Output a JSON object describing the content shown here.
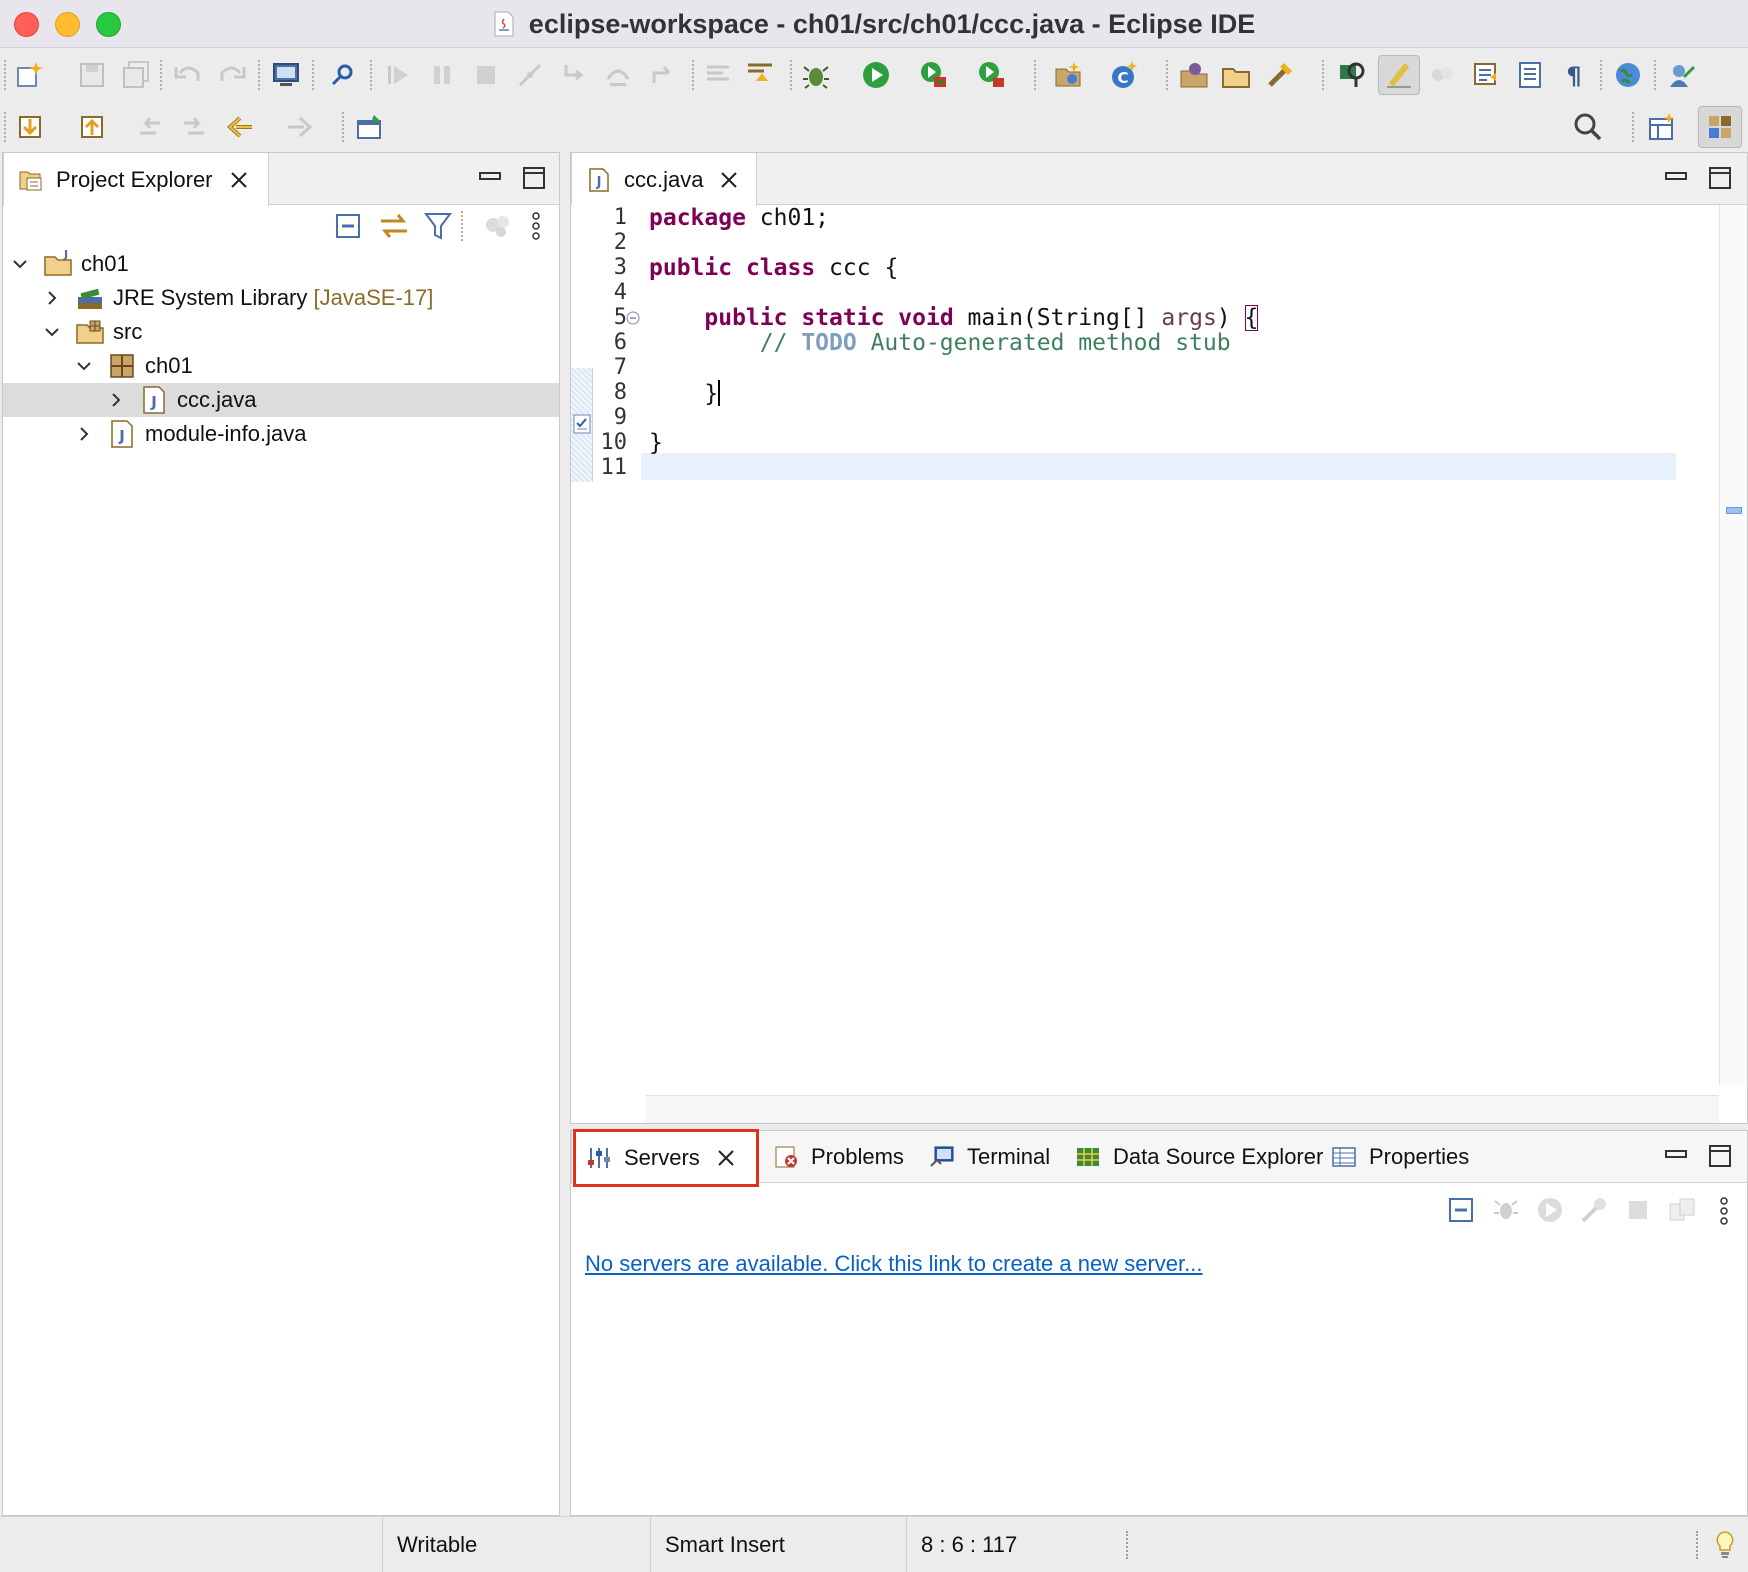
{
  "window": {
    "title": "eclipse-workspace - ch01/src/ch01/ccc.java - Eclipse IDE"
  },
  "project_explorer": {
    "tab_label": "Project Explorer",
    "tree": [
      {
        "label": "ch01",
        "decoration": "",
        "icon": "java-project-icon",
        "expanded": true
      },
      {
        "label": "JRE System Library",
        "decoration": "[JavaSE-17]",
        "icon": "library-icon",
        "expanded": false
      },
      {
        "label": "src",
        "decoration": "",
        "icon": "source-folder-icon",
        "expanded": true
      },
      {
        "label": "ch01",
        "decoration": "",
        "icon": "package-icon",
        "expanded": true
      },
      {
        "label": "ccc.java",
        "decoration": "",
        "icon": "java-file-icon",
        "expanded": false,
        "selected": true
      },
      {
        "label": "module-info.java",
        "decoration": "",
        "icon": "java-file-icon",
        "expanded": false
      }
    ]
  },
  "editor": {
    "tab_label": "ccc.java",
    "line_numbers": [
      "1",
      "2",
      "3",
      "4",
      "5",
      "6",
      "7",
      "8",
      "9",
      "10",
      "11"
    ],
    "lines": {
      "l1_kw": "package",
      "l1_rest": " ch01;",
      "l3_kw1": "public",
      "l3_kw2": "class",
      "l3_rest": " ccc {",
      "l5_kw1": "public",
      "l5_kw2": "static",
      "l5_kw3": "void",
      "l5_rest": " main(String[] ",
      "l5_var": "args",
      "l5_close": ") ",
      "l5_brace": "{",
      "l6_cm1": "// ",
      "l6_todo": "TODO",
      "l6_cm2": " Auto-generated method stub",
      "l8_brace": "}",
      "l10_brace": "}"
    },
    "cursor_position": "8 : 6 : 117"
  },
  "bottom_panel": {
    "tabs": [
      {
        "label": "Servers",
        "icon": "servers-icon",
        "active": true
      },
      {
        "label": "Problems",
        "icon": "problems-icon"
      },
      {
        "label": "Terminal",
        "icon": "terminal-icon"
      },
      {
        "label": "Data Source Explorer",
        "icon": "data-source-icon"
      },
      {
        "label": "Properties",
        "icon": "properties-icon"
      }
    ],
    "servers_message": "No servers are available. Click this link to create a new server..."
  },
  "status_bar": {
    "writable": "Writable",
    "insert_mode": "Smart Insert",
    "position": "8 : 6 : 117"
  },
  "colors": {
    "keyword": "#7f0055",
    "comment": "#3f7f5f",
    "link": "#0a5fc8",
    "highlight_box": "#e0301e"
  }
}
